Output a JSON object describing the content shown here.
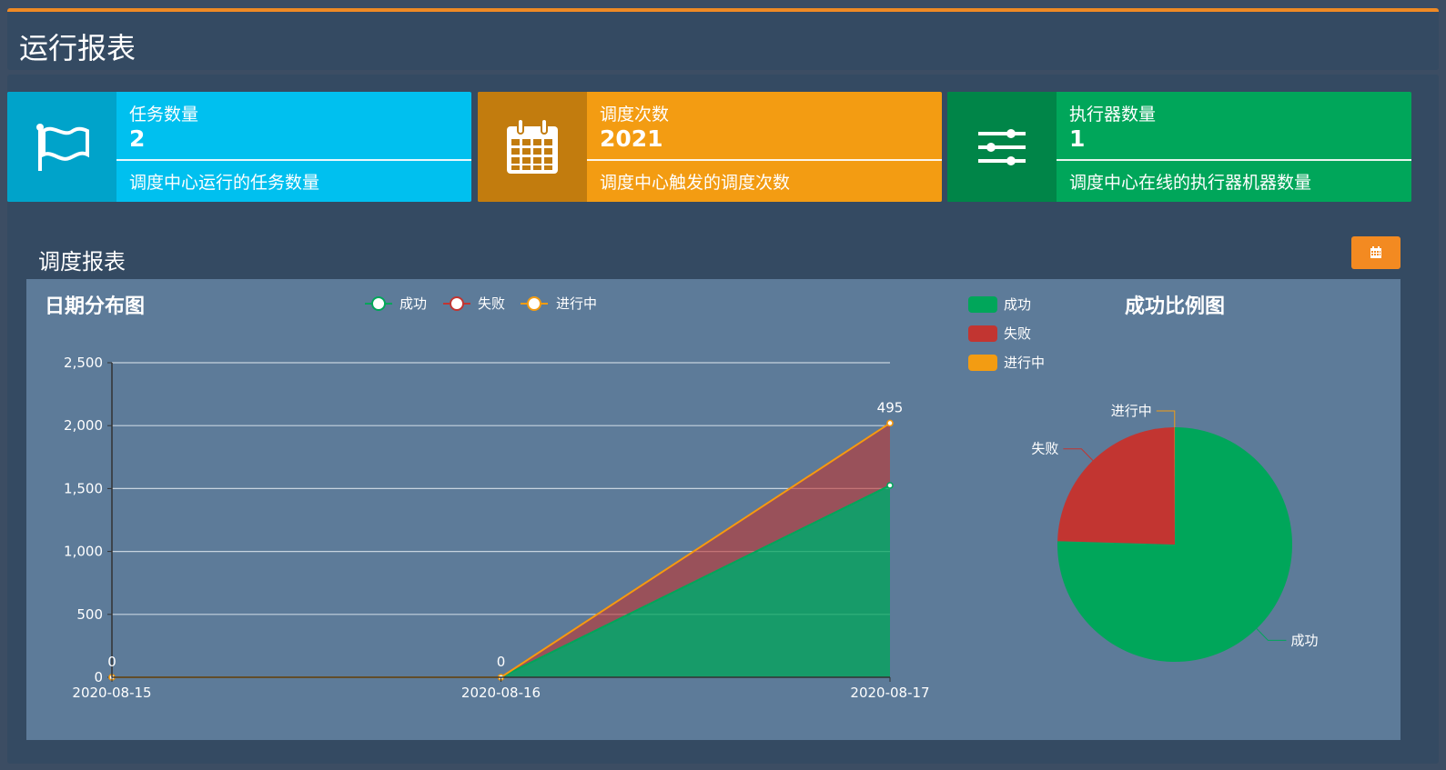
{
  "header": {
    "title": "运行报表"
  },
  "cards": [
    {
      "label": "任务数量",
      "value": "2",
      "desc": "调度中心运行的任务数量",
      "icon": "flag-icon",
      "color": "#00c0ef",
      "icon_bg": "#00a3ca"
    },
    {
      "label": "调度次数",
      "value": "2021",
      "desc": "调度中心触发的调度次数",
      "icon": "calendar-icon",
      "color": "#f39c12",
      "icon_bg": "#c27c0e"
    },
    {
      "label": "执行器数量",
      "value": "1",
      "desc": "调度中心在线的执行器机器数量",
      "icon": "sliders-icon",
      "color": "#00a65a",
      "icon_bg": "#008548"
    }
  ],
  "report": {
    "title": "调度报表",
    "date_button_icon": "calendar-icon"
  },
  "line_chart": {
    "title": "日期分布图",
    "legend": [
      "成功",
      "失败",
      "进行中"
    ]
  },
  "pie_chart": {
    "title": "成功比例图",
    "legend": [
      "成功",
      "失败",
      "进行中"
    ]
  },
  "colors": {
    "success": "#00a65a",
    "fail": "#c23531",
    "running": "#f39c12"
  },
  "chart_data": [
    {
      "type": "area",
      "title": "日期分布图",
      "stacked": true,
      "categories": [
        "2020-08-15",
        "2020-08-16",
        "2020-08-17"
      ],
      "y_ticks": [
        "0",
        "500",
        "1,000",
        "1,500",
        "2,000",
        "2,500"
      ],
      "ylim": [
        0,
        2500
      ],
      "series": [
        {
          "name": "成功",
          "values": [
            0,
            0,
            1525
          ]
        },
        {
          "name": "失败",
          "values": [
            0,
            0,
            495
          ]
        },
        {
          "name": "进行中",
          "values": [
            0,
            0,
            0
          ]
        }
      ],
      "data_labels": [
        "0",
        "0",
        "495"
      ],
      "legend_position": "top-center",
      "grid": true
    },
    {
      "type": "pie",
      "title": "成功比例图",
      "slices": [
        {
          "name": "成功",
          "value": 1525
        },
        {
          "name": "失败",
          "value": 495
        },
        {
          "name": "进行中",
          "value": 1
        }
      ],
      "legend_position": "top-left"
    }
  ]
}
